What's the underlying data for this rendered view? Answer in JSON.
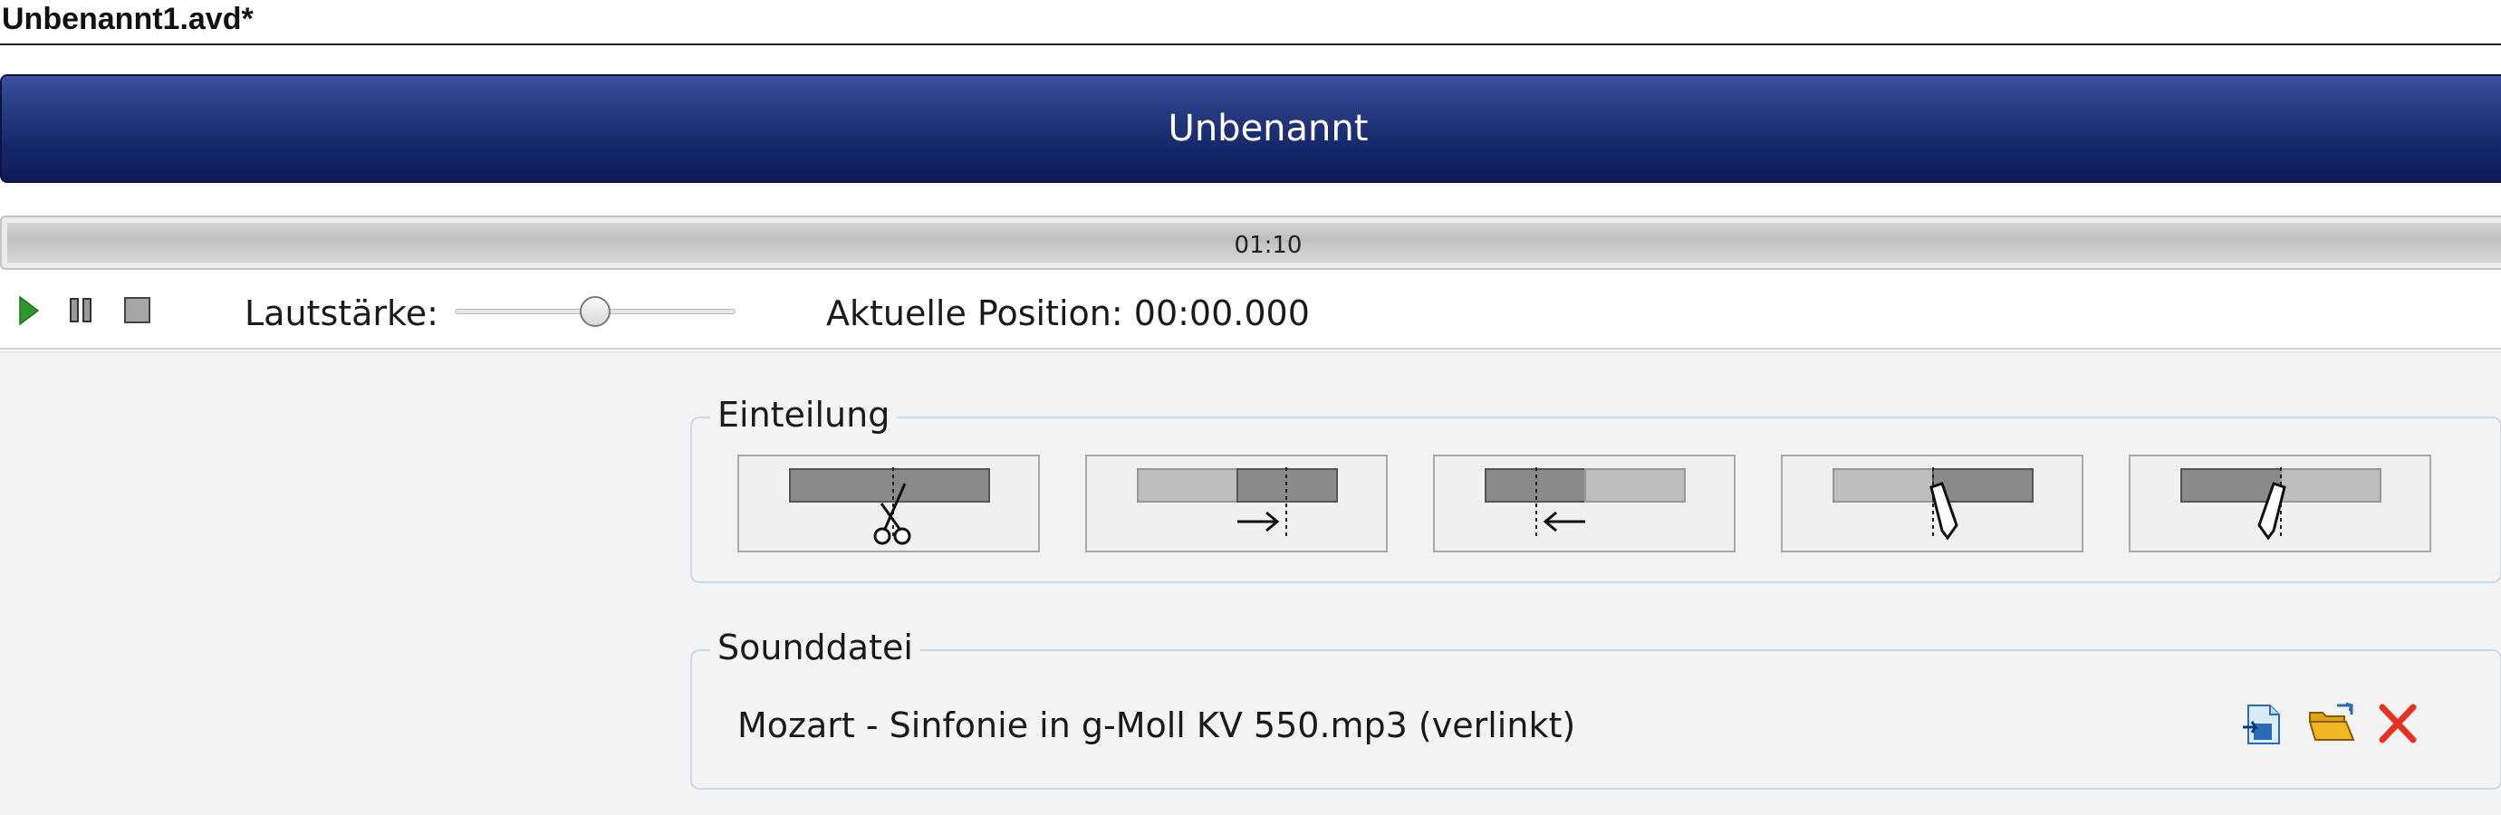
{
  "window": {
    "title": "Unbenannt1.avd*"
  },
  "header": {
    "title": "Unbenannt"
  },
  "timeline": {
    "time_label": "01:10"
  },
  "playback": {
    "play_icon": "play-icon",
    "pause_icon": "pause-icon",
    "stop_icon": "stop-icon",
    "volume_label": "Lautstärke:",
    "volume_level": 0.5,
    "position_label": "Aktuelle Position: 00:00.000"
  },
  "split_group": {
    "legend": "Einteilung",
    "tools": [
      {
        "name": "split-at-position-button",
        "icon": "scissors-icon"
      },
      {
        "name": "move-boundary-right-button",
        "icon": "arrow-right-icon"
      },
      {
        "name": "move-boundary-left-button",
        "icon": "arrow-left-icon"
      },
      {
        "name": "edit-segment-right-button",
        "icon": "pencil-icon"
      },
      {
        "name": "edit-segment-left-button",
        "icon": "pencil-icon"
      }
    ]
  },
  "sound_group": {
    "legend": "Sounddatei",
    "filename": "Mozart - Sinfonie in g-Moll KV 550.mp3 (verlinkt)",
    "actions": [
      {
        "name": "import-file-button",
        "icon": "import-document-icon"
      },
      {
        "name": "open-folder-button",
        "icon": "folder-open-icon"
      },
      {
        "name": "remove-file-button",
        "icon": "close-icon"
      }
    ]
  },
  "colors": {
    "header_gradient_top": "#3d4f9e",
    "header_gradient_bottom": "#0e1b54",
    "play_green": "#2e9a2e",
    "remove_red": "#e53222",
    "folder_yellow": "#f1b623"
  }
}
